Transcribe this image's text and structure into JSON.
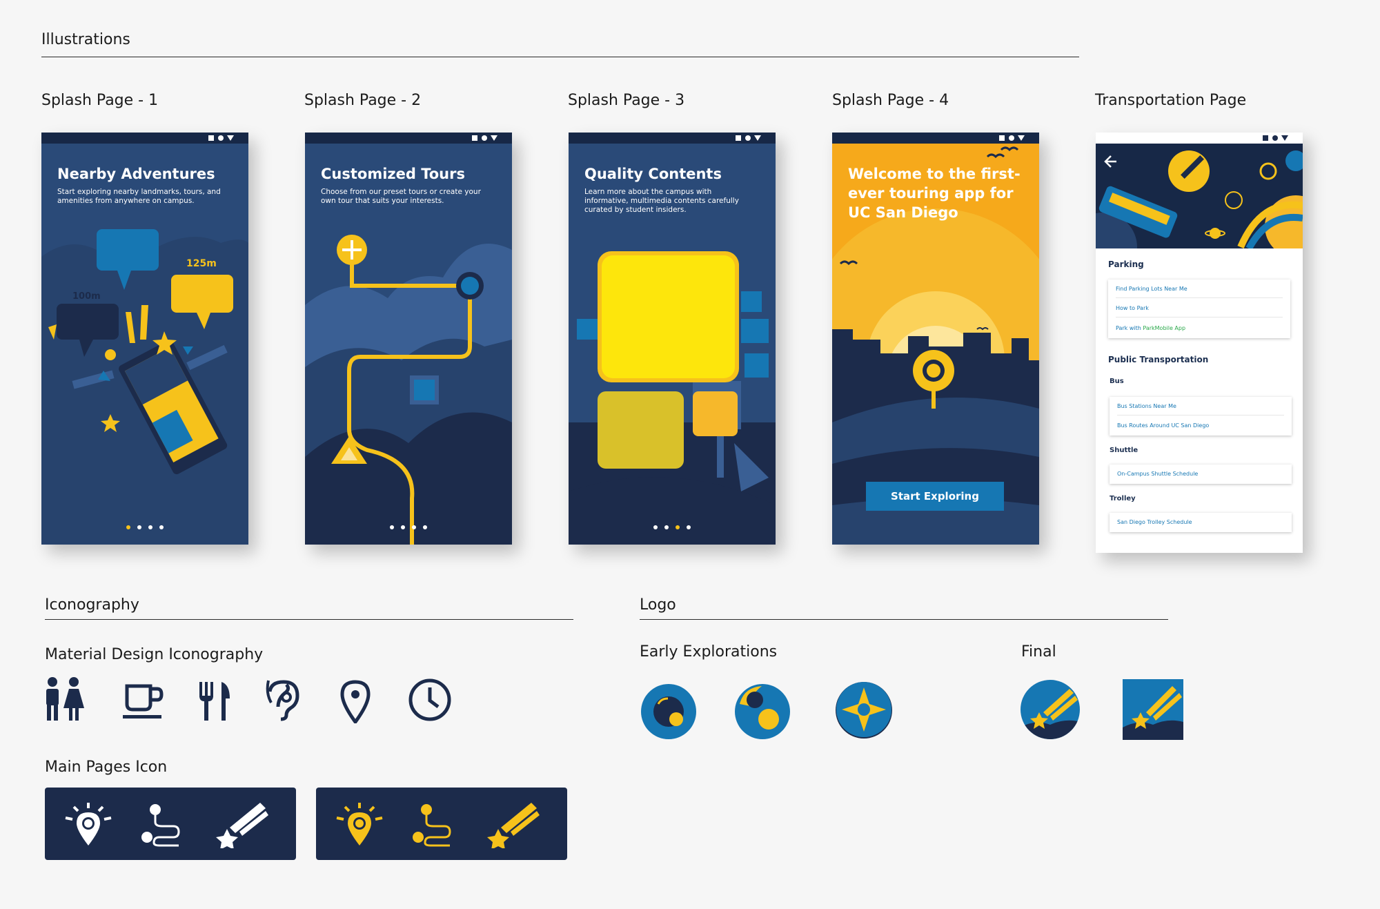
{
  "sections": {
    "illustrations": "Illustrations",
    "iconography": "Iconography",
    "logo": "Logo"
  },
  "screens": [
    {
      "label": "Splash Page - 1",
      "title": "Nearby Adventures",
      "subtitle": "Start exploring nearby landmarks, tours, and amenities from anywhere on campus.",
      "labels": [
        "125m",
        "100m"
      ],
      "active_dot": 0
    },
    {
      "label": "Splash Page - 2",
      "title": "Customized Tours",
      "subtitle": "Choose from our preset tours or create your own tour that suits your interests.",
      "active_dot": 3
    },
    {
      "label": "Splash Page - 3",
      "title": "Quality Contents",
      "subtitle": "Learn more about the campus with informative, multimedia contents carefully curated by student insiders.",
      "active_dot": 2
    },
    {
      "label": "Splash Page - 4",
      "title": "Welcome to the first-ever touring app for UC San Diego",
      "button": "Start Exploring"
    },
    {
      "label": "Transportation Page"
    }
  ],
  "transport": {
    "parking": {
      "title": "Parking",
      "links": [
        "Find Parking Lots Near Me",
        "How to Park",
        "Park with "
      ],
      "parkmobile": "ParkMobile App"
    },
    "public_title": "Public Transportation",
    "bus": {
      "title": "Bus",
      "links": [
        "Bus Stations Near Me",
        "Bus Routes Around UC San Diego"
      ]
    },
    "shuttle": {
      "title": "Shuttle",
      "links": [
        "On-Campus Shuttle Schedule"
      ]
    },
    "trolley": {
      "title": "Trolley",
      "links": [
        "San Diego Trolley Schedule"
      ]
    }
  },
  "iconography": {
    "material_title": "Material Design Iconography",
    "material_icons": [
      "restroom-icon",
      "coffee-icon",
      "restaurant-icon",
      "hearing-icon",
      "location-pin-icon",
      "clock-icon"
    ],
    "main_pages_title": "Main Pages Icon"
  },
  "logo": {
    "early_title": "Early Explorations",
    "final_title": "Final"
  },
  "colors": {
    "navy": "#1c2b4b",
    "blue": "#2a4a78",
    "accent": "#f6c21b",
    "link": "#1677b3"
  }
}
